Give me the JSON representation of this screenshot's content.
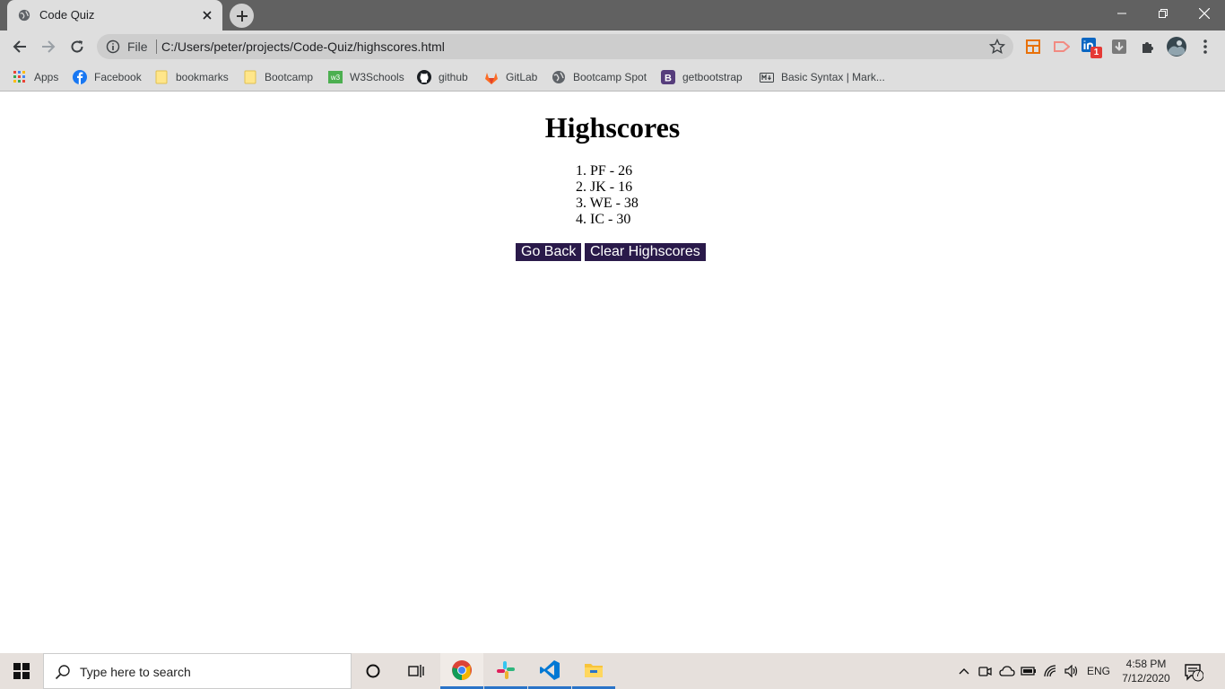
{
  "browser": {
    "tab_title": "Code Quiz",
    "omnibox_scheme_label": "File",
    "url": "C:/Users/peter/projects/Code-Quiz/highscores.html",
    "extension_badge": "1"
  },
  "bookmarks": [
    {
      "label": "Apps",
      "icon": "apps-grid-icon"
    },
    {
      "label": "Facebook",
      "icon": "facebook-icon"
    },
    {
      "label": "bookmarks",
      "icon": "folder-icon"
    },
    {
      "label": "Bootcamp",
      "icon": "folder-icon"
    },
    {
      "label": "W3Schools",
      "icon": "w3schools-icon"
    },
    {
      "label": "github",
      "icon": "github-icon"
    },
    {
      "label": "GitLab",
      "icon": "gitlab-icon"
    },
    {
      "label": "Bootcamp Spot",
      "icon": "globe-icon"
    },
    {
      "label": "getbootstrap",
      "icon": "bootstrap-icon"
    },
    {
      "label": "Basic Syntax | Mark...",
      "icon": "markdown-icon"
    }
  ],
  "page": {
    "heading": "Highscores",
    "scores": [
      "PF - 26",
      "JK - 16",
      "WE - 38",
      "IC - 30"
    ],
    "go_back_label": "Go Back",
    "clear_label": "Clear Highscores"
  },
  "taskbar": {
    "search_placeholder": "Type here to search",
    "language": "ENG",
    "time": "4:58 PM",
    "date": "7/12/2020",
    "notification_count": "7"
  },
  "colors": {
    "button_bg": "#2a1a4a",
    "chrome_frame": "#616161",
    "chrome_toolbar": "#dedede"
  }
}
